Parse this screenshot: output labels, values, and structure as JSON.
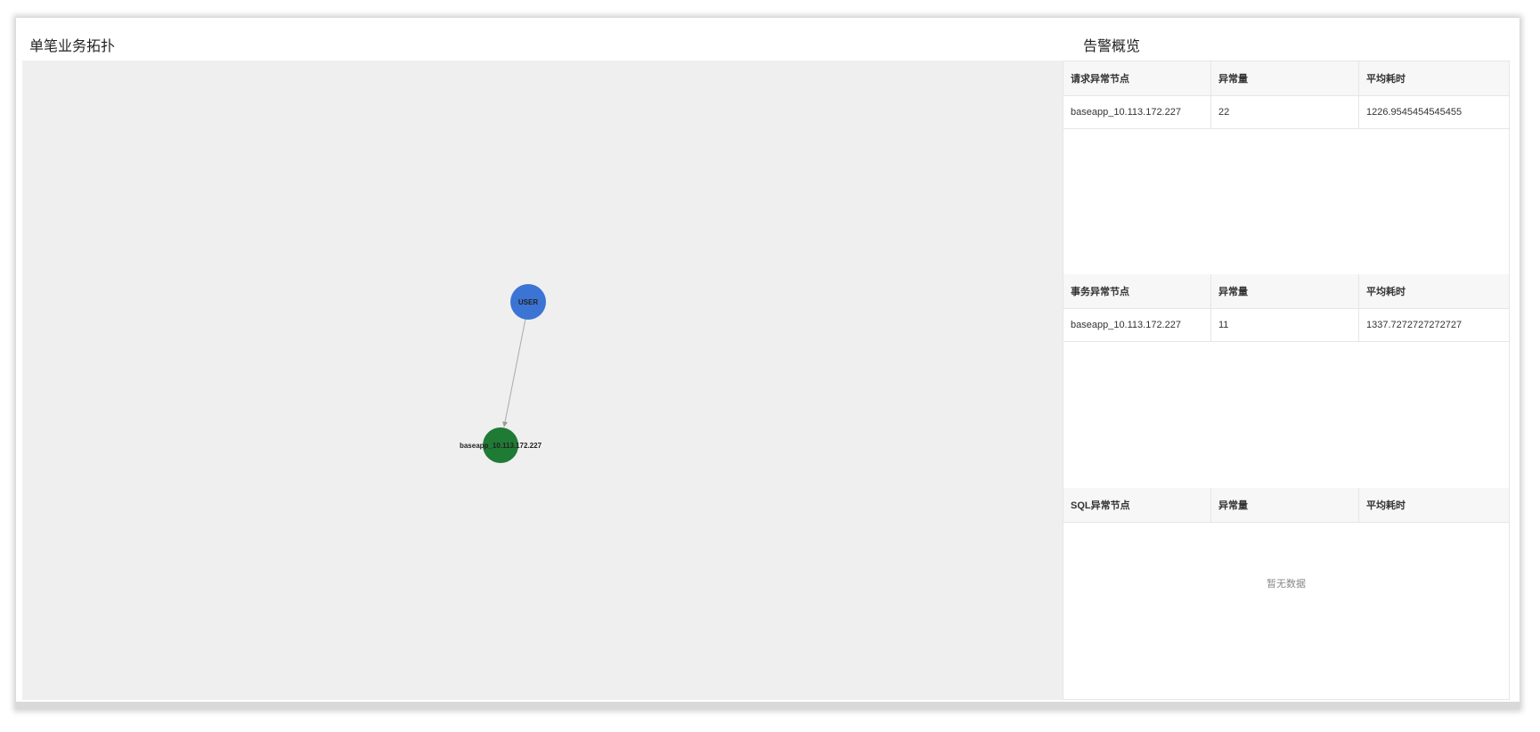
{
  "topology": {
    "title": "单笔业务拓扑",
    "nodes": [
      {
        "id": "user",
        "label": "USER",
        "color": "#3b74d4"
      },
      {
        "id": "baseapp",
        "label": "baseapp_10.113.172.227",
        "color": "#1f7a34"
      }
    ],
    "edges": [
      {
        "from": "USER",
        "to": "baseapp_10.113.172.227"
      }
    ]
  },
  "alerts": {
    "title": "告警概览",
    "request_table": {
      "headers": [
        "请求异常节点",
        "异常量",
        "平均耗时"
      ],
      "rows": [
        [
          "baseapp_10.113.172.227",
          "22",
          "1226.9545454545455"
        ]
      ]
    },
    "transaction_table": {
      "headers": [
        "事务异常节点",
        "异常量",
        "平均耗时"
      ],
      "rows": [
        [
          "baseapp_10.113.172.227",
          "11",
          "1337.7272727272727"
        ]
      ]
    },
    "sql_table": {
      "headers": [
        "SQL异常节点",
        "异常量",
        "平均耗时"
      ],
      "rows": [],
      "empty_text": "暂无数据"
    }
  }
}
